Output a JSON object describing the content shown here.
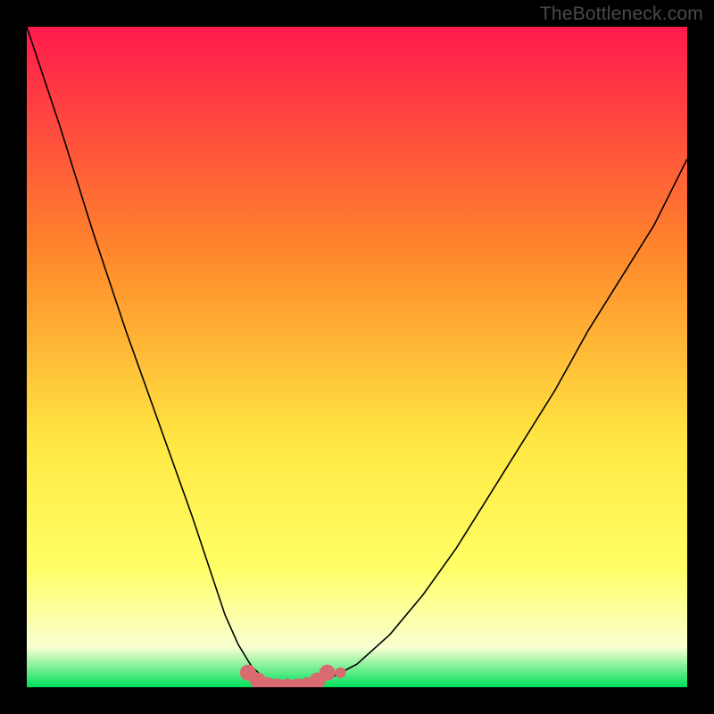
{
  "watermark": "TheBottleneck.com",
  "chart_data": {
    "type": "line",
    "title": "",
    "xlabel": "",
    "ylabel": "",
    "xlim": [
      0,
      100
    ],
    "ylim": [
      0,
      100
    ],
    "grid": false,
    "legend": false,
    "background_gradient": {
      "top": "#ff1a4d",
      "mid_upper": "#ff8a2b",
      "mid": "#ffe843",
      "mid_lower": "#ffff66",
      "near_bottom": "#f9ffd1",
      "bottom": "#00e05a"
    },
    "series": [
      {
        "name": "bottleneck-curve",
        "x": [
          0,
          5,
          10,
          15,
          20,
          25,
          30,
          32,
          34,
          36,
          38,
          40,
          42,
          46,
          50,
          55,
          60,
          65,
          70,
          75,
          80,
          85,
          90,
          95,
          100
        ],
        "y": [
          100,
          85,
          69,
          54,
          40,
          26,
          11,
          6.5,
          3.2,
          1.3,
          0.3,
          0.1,
          0.3,
          1.4,
          3.5,
          8,
          14,
          21,
          29,
          37,
          45,
          54,
          62,
          70,
          80
        ],
        "color": "#000000",
        "linewidth": 1.6
      }
    ],
    "highlight": {
      "name": "flat-minimum-marker",
      "color": "#d96a6f",
      "x": [
        33.5,
        35,
        36.5,
        38,
        39.5,
        41,
        42.5,
        44,
        45.5
      ],
      "y": [
        2.2,
        1.0,
        0.3,
        0.1,
        0.1,
        0.1,
        0.3,
        1.0,
        2.2
      ],
      "marker_size_px": 18,
      "outlier": {
        "x": 47.5,
        "y": 2.2,
        "marker_size_px": 12
      }
    }
  }
}
